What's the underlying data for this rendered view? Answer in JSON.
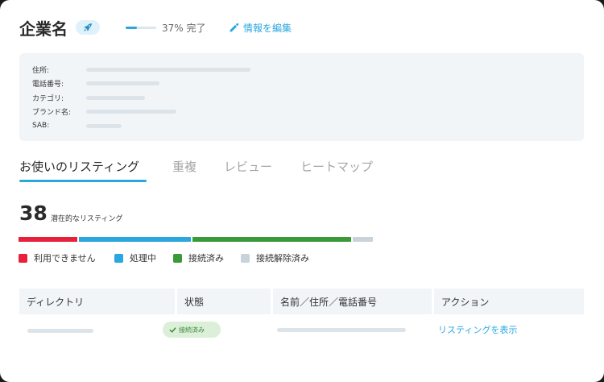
{
  "header": {
    "title": "企業名",
    "rocket_icon": "rocket-icon",
    "progress": {
      "percent": 37,
      "label": "37% 完了"
    },
    "edit": {
      "label": "情報を編集",
      "icon": "pencil-icon"
    }
  },
  "info": {
    "rows": [
      {
        "label": "住所:"
      },
      {
        "label": "電話番号:"
      },
      {
        "label": "カテゴリ:"
      },
      {
        "label": "ブランド名:"
      },
      {
        "label": "SAB:"
      }
    ]
  },
  "tabs": [
    {
      "label": "お使いのリスティング",
      "active": true
    },
    {
      "label": "重複",
      "active": false
    },
    {
      "label": "レビュー",
      "active": false
    },
    {
      "label": "ヒートマップ",
      "active": false
    }
  ],
  "summary": {
    "count": "38",
    "count_label": "潜在的なリスティング"
  },
  "status_breakdown": [
    {
      "name": "利用できません",
      "fraction": 0.17,
      "color": "#e8203a"
    },
    {
      "name": "処理中",
      "fraction": 0.32,
      "color": "#2aa7df"
    },
    {
      "name": "接続済み",
      "fraction": 0.45,
      "color": "#3a9a3a"
    },
    {
      "name": "接続解除済み",
      "fraction": 0.06,
      "color": "#c9d3da"
    }
  ],
  "table": {
    "columns": [
      "ディレクトリ",
      "状態",
      "名前／住所／電話番号",
      "アクション"
    ],
    "rows": [
      {
        "status": "接続済み",
        "action": "リスティングを表示"
      }
    ]
  }
}
